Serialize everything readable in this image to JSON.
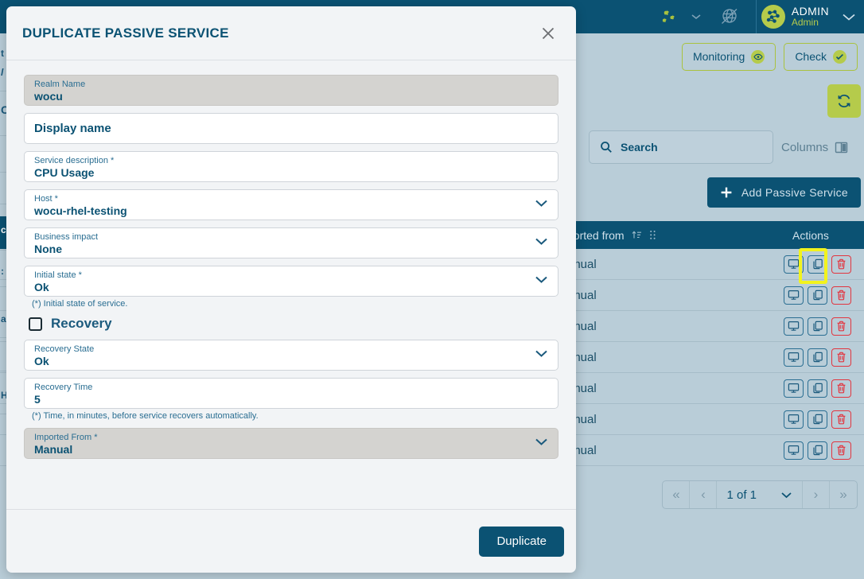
{
  "topbar": {
    "user_name": "ADMIN",
    "user_role": "Admin",
    "gear_icon": "gears-icon",
    "caret_icon": "chevron-down-icon",
    "globe_icon": "no-signal-globe-icon",
    "avatar_icon": "network-avatar-icon"
  },
  "subbar": {
    "monitoring_label": "Monitoring",
    "check_label": "Check",
    "refresh_icon": "refresh-icon"
  },
  "toolbar": {
    "search_label": "Search",
    "search_placeholder": "Search",
    "columns_label": "Columns",
    "add_label": "Add Passive Service"
  },
  "table": {
    "header": {
      "imported_from": "ported from",
      "actions": "Actions"
    },
    "rows": [
      {
        "imported_from": "anual",
        "highlighted": true
      },
      {
        "imported_from": "anual",
        "highlighted": false
      },
      {
        "imported_from": "anual",
        "highlighted": false
      },
      {
        "imported_from": "anual",
        "highlighted": false
      },
      {
        "imported_from": "anual",
        "highlighted": false
      },
      {
        "imported_from": "anual",
        "highlighted": false
      },
      {
        "imported_from": "anual",
        "highlighted": false
      }
    ],
    "action_icons": [
      "monitor-icon",
      "duplicate-icon",
      "trash-icon"
    ]
  },
  "pagination": {
    "first_icon": "«",
    "prev_icon": "‹",
    "page_text": "1 of 1",
    "dropdown_icon": "chevron-down-icon",
    "next_icon": "›",
    "last_icon": "»"
  },
  "modal": {
    "title": "DUPLICATE PASSIVE SERVICE",
    "close_icon": "close-icon",
    "submit_label": "Duplicate",
    "fields": [
      {
        "name": "realm-name",
        "label": "Realm Name",
        "value": "wocu",
        "required": false,
        "readonly": true,
        "type": "text"
      },
      {
        "name": "display-name",
        "label": "Display name",
        "value": "",
        "placeholder": "Display name",
        "required": false,
        "readonly": false,
        "type": "text-empty"
      },
      {
        "name": "service-description",
        "label": "Service description",
        "value": "CPU Usage",
        "required": true,
        "readonly": false,
        "type": "text"
      },
      {
        "name": "host",
        "label": "Host",
        "value": "wocu-rhel-testing",
        "required": true,
        "readonly": false,
        "type": "select"
      },
      {
        "name": "business-impact",
        "label": "Business impact",
        "value": "None",
        "required": false,
        "readonly": false,
        "type": "select"
      },
      {
        "name": "initial-state",
        "label": "Initial state",
        "value": "Ok",
        "required": true,
        "readonly": false,
        "type": "select"
      }
    ],
    "initial_state_helper": "(*) Initial state of service.",
    "recovery_label": "Recovery",
    "recovery_checked": false,
    "recovery_fields": [
      {
        "name": "recovery-state",
        "label": "Recovery State",
        "value": "Ok",
        "required": false,
        "readonly": false,
        "type": "select"
      },
      {
        "name": "recovery-time",
        "label": "Recovery Time",
        "value": "5",
        "required": false,
        "readonly": false,
        "type": "text"
      }
    ],
    "recovery_helper": "(*) Time, in minutes, before service recovers automatically.",
    "imported_from_field": {
      "name": "imported-from",
      "label": "Imported From",
      "value": "Manual",
      "required": true,
      "readonly": true,
      "type": "select"
    }
  },
  "colors": {
    "brand_blue": "#0b5273",
    "accent_green": "#b5cb4b",
    "danger_red": "#e2353f",
    "highlight_yellow": "#f2f31d",
    "page_bg": "#b9cdd8",
    "modal_bg": "#f2f4f6",
    "readonly_bg": "#d4d3d0"
  }
}
